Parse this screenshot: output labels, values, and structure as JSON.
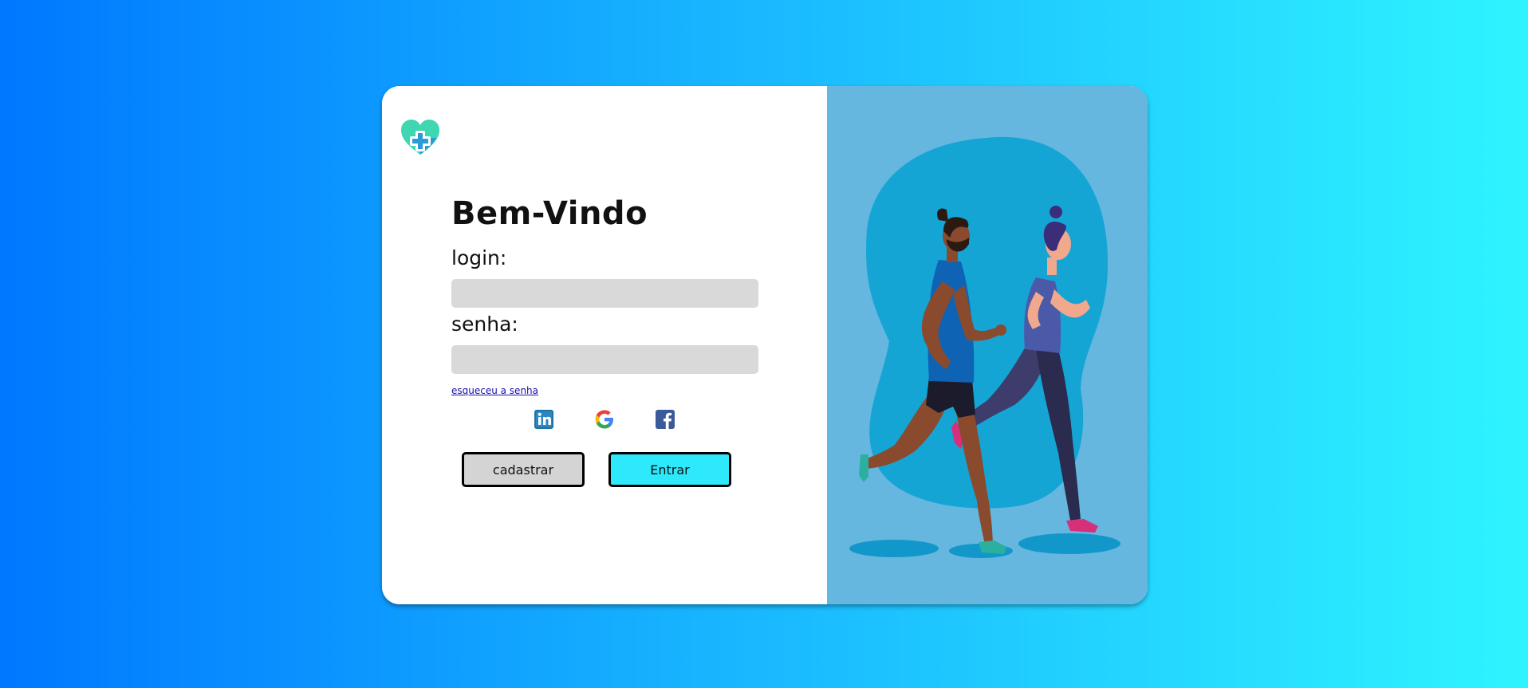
{
  "colors": {
    "accent": "#2ee9fb",
    "secondary_button": "#d4d4d4",
    "input_background": "#d9d9d9",
    "illustration_background": "#65b7e0",
    "link": "#1a0dab"
  },
  "brand": {
    "logo_icon": "heart-plus-icon"
  },
  "form": {
    "title": "Bem-Vindo",
    "login_label": "login:",
    "login_value": "",
    "password_label": "senha:",
    "password_value": "",
    "forgot_link": "esqueceu a senha"
  },
  "social": {
    "icons": [
      "linkedin-icon",
      "google-icon",
      "facebook-icon"
    ]
  },
  "buttons": {
    "register_label": "cadastrar",
    "login_label": "Entrar"
  },
  "illustration": {
    "icon": "runners-illustration"
  }
}
